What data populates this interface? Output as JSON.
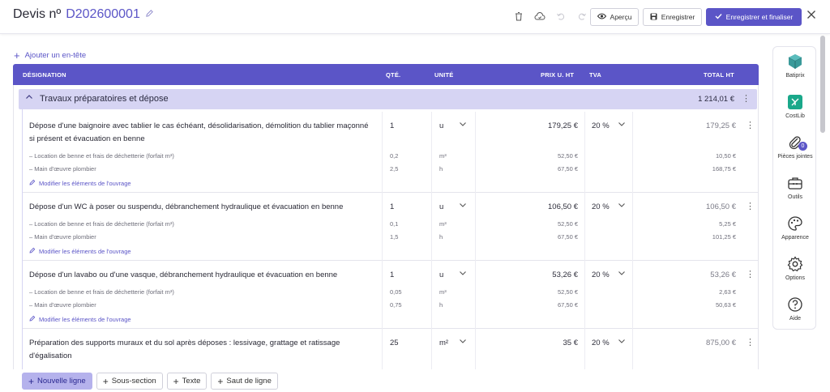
{
  "header": {
    "title_prefix": "Devis nº",
    "number": "D202600001",
    "apercu_label": "Aperçu",
    "save_label": "Enregistrer",
    "finalize_label": "Enregistrer et finaliser"
  },
  "add_header_label": "Ajouter un en-tête",
  "table_headers": {
    "designation": "DÉSIGNATION",
    "qty": "QTÉ.",
    "unit": "UNITÉ",
    "unit_price": "PRIX U. HT",
    "tva": "TVA",
    "total": "TOTAL HT"
  },
  "section": {
    "title": "Travaux préparatoires et dépose",
    "total": "1 214,01 €"
  },
  "modify_label": "Modifier les éléments de l'ouvrage",
  "items": [
    {
      "desc": "Dépose d'une baignoire avec tablier le cas échéant, désolidarisation, démolition du tablier maçonné si présent et évacuation en benne",
      "qty": "1",
      "unit": "u",
      "price": "179,25 €",
      "tva": "20 %",
      "total": "179,25 €",
      "subs": [
        {
          "label": "– Location de benne et frais de déchetterie (forfait m³)",
          "qty": "0,2",
          "unit": "m³",
          "price": "52,50 €",
          "total": "10,50 €"
        },
        {
          "label": "– Main d'œuvre plombier",
          "qty": "2,5",
          "unit": "h",
          "price": "67,50 €",
          "total": "168,75 €"
        }
      ]
    },
    {
      "desc": "Dépose d'un WC à poser ou suspendu, débranchement hydraulique et évacuation en benne",
      "qty": "1",
      "unit": "u",
      "price": "106,50 €",
      "tva": "20 %",
      "total": "106,50 €",
      "subs": [
        {
          "label": "– Location de benne et frais de déchetterie (forfait m³)",
          "qty": "0,1",
          "unit": "m³",
          "price": "52,50 €",
          "total": "5,25 €"
        },
        {
          "label": "– Main d'œuvre plombier",
          "qty": "1,5",
          "unit": "h",
          "price": "67,50 €",
          "total": "101,25 €"
        }
      ]
    },
    {
      "desc": "Dépose d'un lavabo ou d'une vasque, débranchement hydraulique et évacuation en benne",
      "qty": "1",
      "unit": "u",
      "price": "53,26 €",
      "tva": "20 %",
      "total": "53,26 €",
      "subs": [
        {
          "label": "– Location de benne et frais de déchetterie (forfait m³)",
          "qty": "0,05",
          "unit": "m³",
          "price": "52,50 €",
          "total": "2,63 €"
        },
        {
          "label": "– Main d'œuvre plombier",
          "qty": "0,75",
          "unit": "h",
          "price": "67,50 €",
          "total": "50,63 €"
        }
      ]
    },
    {
      "desc": "Préparation des supports muraux et du sol après déposes : lessivage, grattage et ratissage d'égalisation",
      "qty": "25",
      "unit": "m²",
      "price": "35 €",
      "tva": "20 %",
      "total": "875,00 €",
      "subs": []
    }
  ],
  "bottom_buttons": {
    "new_line": "Nouvelle ligne",
    "sub_section": "Sous-section",
    "text": "Texte",
    "page_break": "Saut de ligne"
  },
  "sidebar": [
    {
      "label": "Batiprix",
      "icon": "batiprix-cube-icon"
    },
    {
      "label": "CostLib",
      "icon": "costlib-icon"
    },
    {
      "label": "Pièces jointes",
      "icon": "paperclip-icon",
      "badge": "0"
    },
    {
      "label": "Outils",
      "icon": "toolbox-icon"
    },
    {
      "label": "Apparence",
      "icon": "palette-icon"
    },
    {
      "label": "Options",
      "icon": "gear-icon"
    },
    {
      "label": "Aide",
      "icon": "help-icon"
    }
  ],
  "colors": {
    "accent": "#5b55c7",
    "section_bg": "#d6d4f3",
    "batiprix": "#3a9a9a",
    "costlib": "#1aa88a"
  }
}
